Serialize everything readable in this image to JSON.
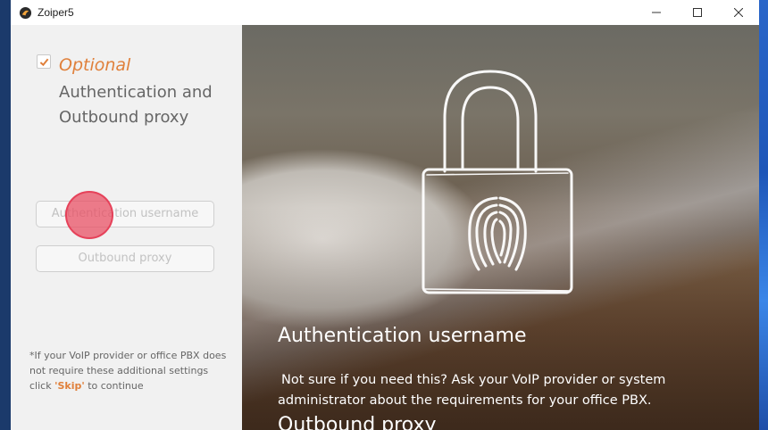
{
  "window": {
    "title": "Zoiper5",
    "app_icon": "zoiper-icon",
    "controls": [
      "minimize-icon",
      "maximize-icon",
      "close-icon"
    ]
  },
  "left_panel": {
    "checkbox_checked": true,
    "optional_label": "Optional",
    "heading": "Authentication and Outbound proxy",
    "fields": {
      "auth_username": {
        "value": "",
        "placeholder": "Authentication username"
      },
      "outbound_proxy": {
        "value": "",
        "placeholder": "Outbound proxy"
      }
    },
    "footnote": {
      "before": "*If your VoIP provider or office PBX does not require these additional settings click ",
      "quote_open": "'",
      "skip": "Skip",
      "quote_close": "'",
      "after": " to continue"
    }
  },
  "right_panel": {
    "title": "Authentication username",
    "description": "Not sure if you need this? Ask your VoIP provider or system administrator about the requirements for your office PBX.",
    "title2": "Outbound proxy",
    "illustration": "lock-fingerprint-icon"
  },
  "colors": {
    "accent": "#e0803b",
    "title_bar": "#ffffff",
    "panel_bg": "#f1f1f1",
    "click_marker": "#e85064"
  }
}
